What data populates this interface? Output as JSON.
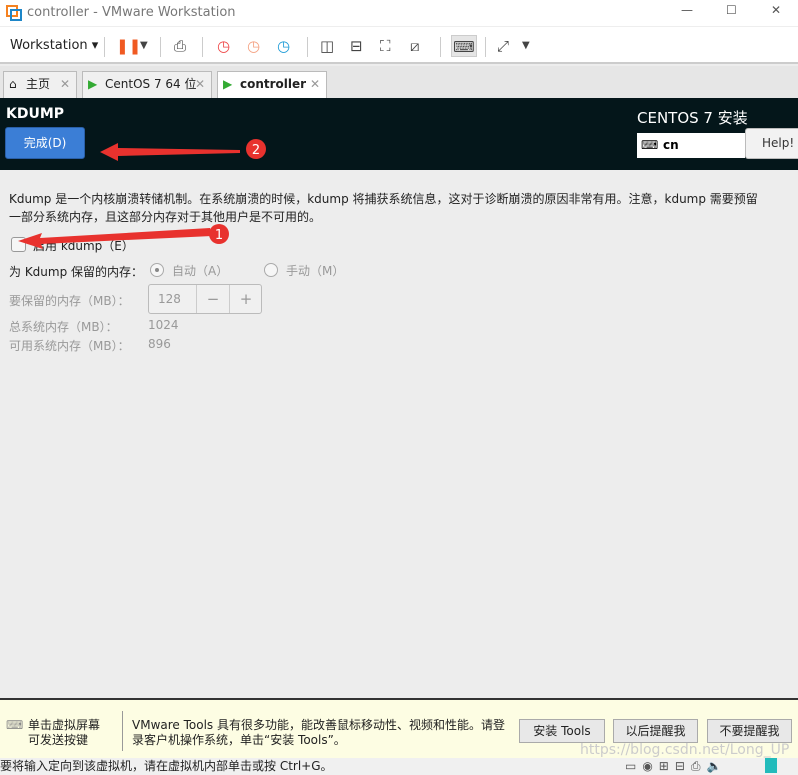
{
  "window": {
    "title": "controller - VMware Workstation"
  },
  "toolbar": {
    "workstation_label": "Workstation"
  },
  "tabs": [
    {
      "label": "主页"
    },
    {
      "label": "CentOS 7 64 位"
    },
    {
      "label": "controller"
    }
  ],
  "header": {
    "page_title": "KDUMP",
    "done_label": "完成(D)",
    "install_title": "CENTOS 7 安装",
    "keyboard_layout": "cn",
    "help_label": "Help!"
  },
  "content": {
    "description_line1": "Kdump 是一个内核崩溃转储机制。在系统崩溃的时候，kdump 将捕获系统信息，这对于诊断崩溃的原因非常有用。注意，kdump 需要预留",
    "description_line2": "一部分系统内存，且这部分内存对于其他用户是不可用的。",
    "enable_label": "启用 kdump（E）",
    "enable_checked": false,
    "reserve_label": "为 Kdump 保留的内存：",
    "auto_label": "自动（A）",
    "manual_label": "手动（M）",
    "selected_mode": "auto",
    "reserved_label": "要保留的内存（MB）：",
    "reserved_value": "128",
    "minus": "−",
    "plus": "+",
    "total_label": "总系统内存（MB）：",
    "total_value": "1024",
    "usable_label": "可用系统内存（MB）：",
    "usable_value": "896"
  },
  "annotations": {
    "marker1": "1",
    "marker2": "2",
    "color": "#e8322e"
  },
  "banner": {
    "hint_line1": "单击虚拟屏幕",
    "hint_line2": "可发送按键",
    "msg_line1": "VMware Tools 具有很多功能，能改善鼠标移动性、视频和性能。请登",
    "msg_line2": "录客户机操作系统，单击“安装 Tools”。",
    "install_tools": "安装 Tools",
    "remind_later": "以后提醒我",
    "never_remind": "不要提醒我"
  },
  "statusbar": {
    "text": "要将输入定向到该虚拟机，请在虚拟机内部单击或按 Ctrl+G。",
    "watermark": "https://blog.csdn.net/Long_UP"
  }
}
